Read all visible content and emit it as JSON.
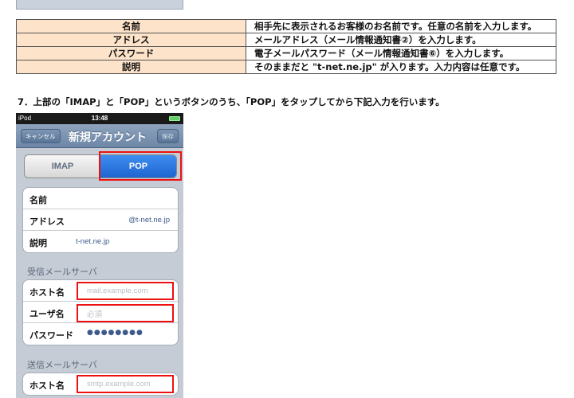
{
  "table": {
    "rows": [
      {
        "key": "名前",
        "value": "相手先に表示されるお客様のお名前です。任意の名前を入力します。"
      },
      {
        "key": "アドレス",
        "value": "メールアドレス（メール情報通知書②）を入力します。"
      },
      {
        "key": "パスワード",
        "value": "電子メールパスワード（メール情報通知書⑥）を入力します。"
      },
      {
        "key": "説明",
        "value": "そのままだと \"t-net.ne.jp\" が入ります。入力内容は任意です。"
      }
    ]
  },
  "instruction": "7．上部の「IMAP」と「POP」というボタンのうち、「POP」をタップしてから下記入力を行います。",
  "phone": {
    "carrier": "iPod",
    "time": "13:48",
    "nav": {
      "cancel": "キャンセル",
      "title": "新規アカウント",
      "save": "保存"
    },
    "segment": {
      "imap": "IMAP",
      "pop": "POP"
    },
    "account": {
      "name_label": "名前",
      "address_label": "アドレス",
      "address_value": "@t-net.ne.jp",
      "desc_label": "説明",
      "desc_value": "t-net.ne.jp"
    },
    "incoming": {
      "header": "受信メールサーバ",
      "host_label": "ホスト名",
      "host_placeholder": "mail.example.com",
      "user_label": "ユーザ名",
      "user_placeholder": "必須",
      "password_label": "パスワード",
      "password_value": "●●●●●●●●"
    },
    "outgoing": {
      "header": "送信メールサーバ",
      "host_label": "ホスト名",
      "host_placeholder": "smtp.example.com"
    }
  }
}
